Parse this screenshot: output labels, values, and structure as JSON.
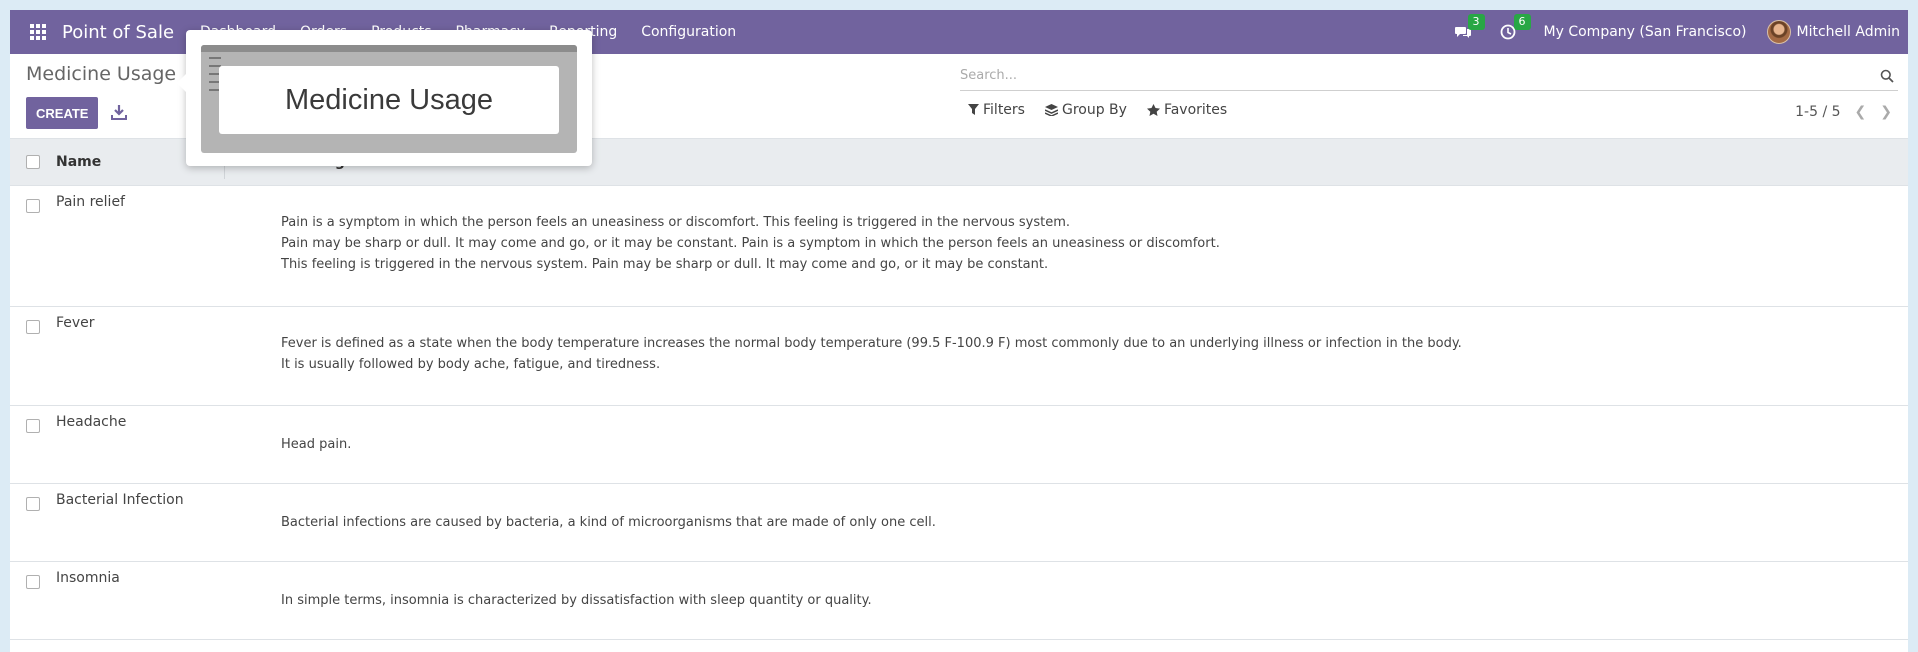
{
  "navbar": {
    "brand": "Point of Sale",
    "menu": [
      "Dashboard",
      "Orders",
      "Products",
      "Pharmacy",
      "Reporting",
      "Configuration"
    ],
    "messages_count": "3",
    "activities_count": "6",
    "company": "My Company (San Francisco)",
    "user": "Mitchell Admin",
    "badge_color": "#28a745",
    "brand_color": "#71639e"
  },
  "control_panel": {
    "title": "Medicine Usage",
    "create_label": "CREATE",
    "search_placeholder": "Search...",
    "filters_label": "Filters",
    "group_by_label": "Group By",
    "favorites_label": "Favorites",
    "pager": "1-5 / 5"
  },
  "table": {
    "headers": {
      "name": "Name",
      "usage": "Medicine Usage"
    },
    "rows": [
      {
        "name": "Pain relief",
        "usage_lines": [
          "Pain is a symptom in which the person feels an uneasiness or discomfort. This feeling is triggered in the nervous system.",
          "Pain may be sharp or dull. It may come and go, or it may be constant. Pain is a symptom in which the person feels an uneasiness or discomfort.",
          "This feeling is triggered in the nervous system. Pain may be sharp or dull. It may come and go, or it may be constant."
        ]
      },
      {
        "name": "Fever",
        "usage_lines": [
          "Fever is defined as a state when the body temperature increases the normal body temperature (99.5 F-100.9 F) most commonly due to an underlying illness or infection in the body.",
          "It is usually followed by body ache, fatigue, and tiredness."
        ]
      },
      {
        "name": "Headache",
        "usage_lines": [
          "Head pain."
        ]
      },
      {
        "name": "Bacterial Infection",
        "usage_lines": [
          "Bacterial infections are caused by bacteria, a kind of microorganisms that are made of only one cell."
        ]
      },
      {
        "name": "Insomnia",
        "usage_lines": [
          "In simple terms, insomnia is characterized by dissatisfaction with sleep quantity or quality."
        ]
      }
    ]
  },
  "popover": {
    "label": "Medicine Usage"
  }
}
